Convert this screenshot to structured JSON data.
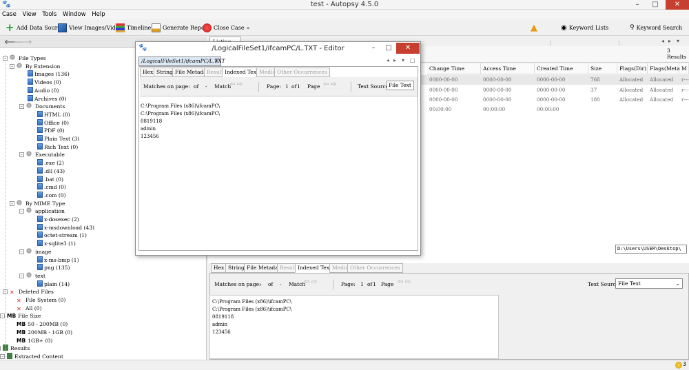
{
  "window": {
    "title": "test - Autopsy 4.5.0",
    "min": "–",
    "max": "□",
    "close": "✕"
  },
  "menu": [
    "Case",
    "View",
    "Tools",
    "Window",
    "Help"
  ],
  "toolbar": {
    "add_data_source": "Add Data Source",
    "view_images_videos": "View Images/Videos",
    "timeline": "Timeline",
    "generate_report": "Generate Report",
    "close_case": "Close Case",
    "keyword_lists": "Keyword Lists",
    "keyword_search": "Keyword Search"
  },
  "tree": {
    "items": [
      {
        "label": "File Types",
        "icon": "folder-icon"
      },
      {
        "label": "By Extension",
        "icon": "folder-icon"
      },
      {
        "label": "Images (136)",
        "icon": "file-icon"
      },
      {
        "label": "Videos (0)",
        "icon": "file-icon"
      },
      {
        "label": "Audio (0)",
        "icon": "file-icon"
      },
      {
        "label": "Archives (0)",
        "icon": "file-icon"
      },
      {
        "label": "Documents",
        "icon": "folder-icon"
      },
      {
        "label": "HTML (0)",
        "icon": "file-icon"
      },
      {
        "label": "Office (0)",
        "icon": "file-icon"
      },
      {
        "label": "PDF (0)",
        "icon": "file-icon"
      },
      {
        "label": "Plain Text (3)",
        "icon": "file-icon"
      },
      {
        "label": "Rich Text (0)",
        "icon": "file-icon"
      },
      {
        "label": "Executable",
        "icon": "folder-icon"
      },
      {
        "label": ".exe (2)",
        "icon": "file-icon"
      },
      {
        "label": ".dll (43)",
        "icon": "file-icon"
      },
      {
        "label": ".bat (0)",
        "icon": "file-icon"
      },
      {
        "label": ".cmd (0)",
        "icon": "file-icon"
      },
      {
        "label": ".com (0)",
        "icon": "file-icon"
      },
      {
        "label": "By MIME Type",
        "icon": "folder-icon"
      },
      {
        "label": "application",
        "icon": "folder-icon"
      },
      {
        "label": "x-dosexec (2)",
        "icon": "file-icon"
      },
      {
        "label": "x-msdownload (43)",
        "icon": "file-icon"
      },
      {
        "label": "octet-stream (1)",
        "icon": "file-icon"
      },
      {
        "label": "x-sqlite3 (1)",
        "icon": "file-icon"
      },
      {
        "label": "image",
        "icon": "folder-icon"
      },
      {
        "label": "x-ms-bmp (1)",
        "icon": "file-icon"
      },
      {
        "label": "png (135)",
        "icon": "file-icon"
      },
      {
        "label": "text",
        "icon": "folder-icon"
      },
      {
        "label": "plain (14)",
        "icon": "file-icon"
      },
      {
        "label": "Deleted Files",
        "icon": "deleted-icon"
      },
      {
        "label": "File System (0)",
        "icon": "deleted-icon"
      },
      {
        "label": "All (0)",
        "icon": "deleted-icon"
      },
      {
        "label": "File Size",
        "icon": "mb-icon"
      },
      {
        "label": "50 - 200MB (0)",
        "icon": "mb-icon"
      },
      {
        "label": "200MB - 1GB (0)",
        "icon": "mb-icon"
      },
      {
        "label": "1GB+ (0)",
        "icon": "mb-icon"
      },
      {
        "label": "Results",
        "icon": "results-icon"
      },
      {
        "label": "Extracted Content",
        "icon": "results-icon"
      }
    ],
    "mb_label": "MB"
  },
  "listing": {
    "tab": "Listing",
    "count": "3",
    "results_label": "Results",
    "columns": [
      "Change Time",
      "Access Time",
      "Created Time",
      "Size",
      "Flags(Dir)",
      "Flags(Meta)",
      "M"
    ],
    "rows": [
      {
        "change": "0000-00-00 00:00:00",
        "access": "0000-00-00 00:00:00",
        "created": "0000-00-00 00:00:00",
        "size": "768",
        "flags_dir": "Allocated",
        "flags_meta": "Allocated",
        "m": "r---"
      },
      {
        "change": "0000-00-00 00:00:00",
        "access": "0000-00-00 00:00:00",
        "created": "0000-00-00 00:00:00",
        "size": "37",
        "flags_dir": "Allocated",
        "flags_meta": "Allocated",
        "m": "r---"
      },
      {
        "change": "0000-00-00 00:00:00",
        "access": "0000-00-00 00:00:00",
        "created": "0000-00-00 00:00:00",
        "size": "180",
        "flags_dir": "Allocated",
        "flags_meta": "Allocated",
        "m": "r---"
      }
    ],
    "path": "D:\\Users\\USER\\Desktop\\"
  },
  "viewer": {
    "tabs": [
      "Hex",
      "Strings",
      "File Metadata",
      "Results",
      "Indexed Text",
      "Media",
      "Other Occurrences"
    ],
    "matches_label": "Matches on page:",
    "dash": "-",
    "of_label": "of",
    "match_label": "Match",
    "page_label": "Page:",
    "page_num": "1",
    "page_of": "of",
    "page_total": "1",
    "page_word": "Page",
    "text_source_label": "Text Source:",
    "text_source_value": "File Text",
    "lines": [
      "C:\\Program Files (x86)\\ifcamPC\\",
      "C:\\Program Files (x86)\\ifcamPC\\",
      "0819118",
      "admin",
      "123456"
    ]
  },
  "editor": {
    "title": "/LogicalFileSet1/ifcamPC/L.TXT - Editor",
    "tab_label": "/LogicalFileSet1/ifcamPC/L.TXT",
    "tab_close": "✕",
    "text_source_value": "File Text"
  },
  "status": {
    "badge": "3"
  }
}
